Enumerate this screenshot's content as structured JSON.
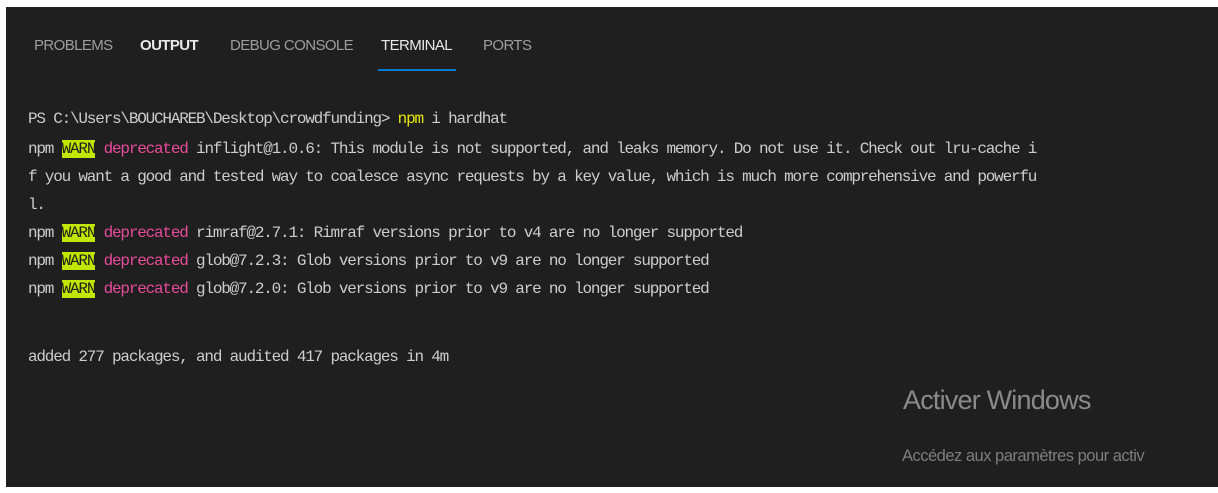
{
  "tabs": [
    {
      "label": "PROBLEMS"
    },
    {
      "label": "OUTPUT"
    },
    {
      "label": "DEBUG CONSOLE"
    },
    {
      "label": "TERMINAL"
    },
    {
      "label": "PORTS"
    }
  ],
  "active_tab": "TERMINAL",
  "terminal": {
    "prompt": "PS C:\\Users\\BOUCHAREB\\Desktop\\crowdfunding> ",
    "command_npm": "npm",
    "command_args": " i hardhat",
    "warnings": [
      {
        "prefix": "npm ",
        "level": "WARN",
        "kind": " deprecated",
        "lines": [
          " inflight@1.0.6: This module is not supported, and leaks memory. Do not use it. Check out lru-cache i",
          "f you want a good and tested way to coalesce async requests by a key value, which is much more comprehensive and powerfu",
          "l."
        ]
      },
      {
        "prefix": "npm ",
        "level": "WARN",
        "kind": " deprecated",
        "lines": [
          " rimraf@2.7.1: Rimraf versions prior to v4 are no longer supported"
        ]
      },
      {
        "prefix": "npm ",
        "level": "WARN",
        "kind": " deprecated",
        "lines": [
          " glob@7.2.3: Glob versions prior to v9 are no longer supported"
        ]
      },
      {
        "prefix": "npm ",
        "level": "WARN",
        "kind": " deprecated",
        "lines": [
          " glob@7.2.0: Glob versions prior to v9 are no longer supported"
        ]
      }
    ],
    "summary": "added 277 packages, and audited 417 packages in 4m"
  },
  "watermark": {
    "title": "Activer Windows",
    "subtitle": "Accédez aux paramètres pour activ"
  },
  "colors": {
    "background": "#1f1f1f",
    "tab_active_underline": "#0078d4",
    "command": "#e5e510",
    "warn_bg": "#c3e600",
    "deprecated": "#e84a9b",
    "text": "#cccccc"
  }
}
